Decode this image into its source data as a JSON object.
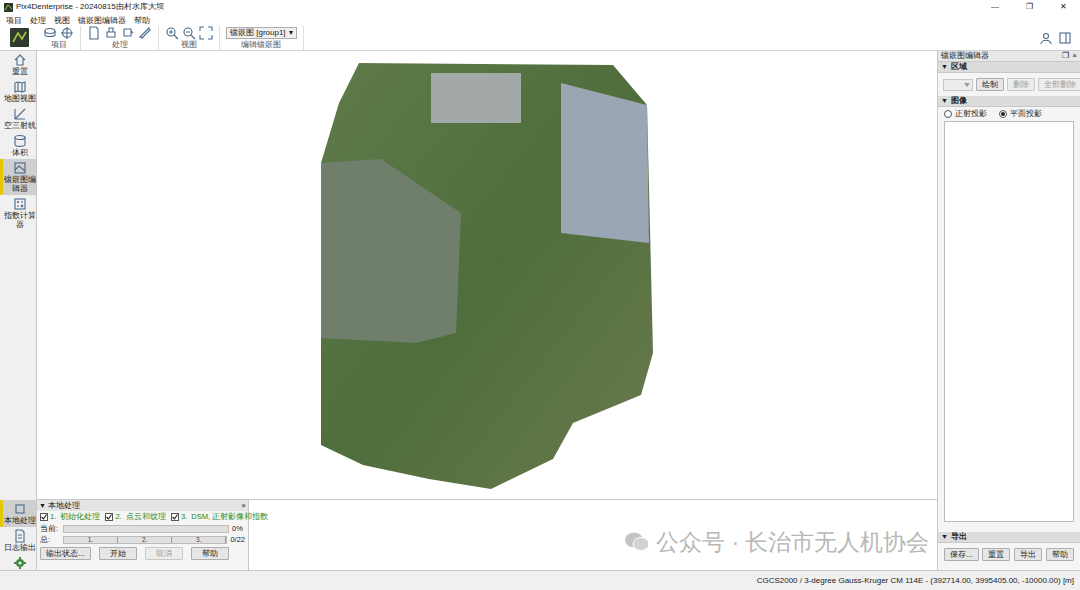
{
  "window": {
    "title": "Pix4Denterprise - 20240815由村水库大坝",
    "controls": [
      "—",
      "❐",
      "✕"
    ]
  },
  "menu": [
    "项目",
    "处理",
    "视图",
    "镶嵌图编辑器",
    "帮助"
  ],
  "toolbar": {
    "groups": [
      "项目",
      "处理",
      "视图",
      "编辑镶嵌图"
    ],
    "view_select": "镶嵌图 [group1]",
    "select_arrow": "▾"
  },
  "sidebar": {
    "items": [
      {
        "label": "重置",
        "selected": false
      },
      {
        "label": "地图视图",
        "selected": false
      },
      {
        "label": "空三射线",
        "selected": false
      },
      {
        "label": "体积",
        "selected": false
      },
      {
        "label": "镶嵌图编辑器",
        "selected": true
      },
      {
        "label": "指数计算器",
        "selected": false
      }
    ],
    "bottom_items": [
      {
        "label": "本地处理",
        "selected": true
      },
      {
        "label": "日志输出",
        "selected": false
      },
      {
        "label": "处理选项",
        "selected": false
      }
    ]
  },
  "right_panel": {
    "title": "镶嵌图编辑器",
    "controls": [
      "❐",
      "×"
    ],
    "region": {
      "arrow": "▼",
      "header": "区域",
      "buttons": [
        {
          "label": "绘制",
          "disabled": false
        },
        {
          "label": "删除",
          "disabled": true
        },
        {
          "label": "全部删除",
          "disabled": true
        }
      ]
    },
    "image": {
      "arrow": "▼",
      "header": "图像",
      "options": [
        {
          "label": "正射投影",
          "selected": false
        },
        {
          "label": "平面投影",
          "selected": true
        }
      ]
    },
    "export": {
      "arrow": "▼",
      "header": "导出",
      "buttons": [
        {
          "label": "保存...",
          "disabled": false
        },
        {
          "label": "重置",
          "disabled": false
        },
        {
          "label": "导出",
          "disabled": false
        },
        {
          "label": "帮助",
          "disabled": false
        }
      ]
    }
  },
  "processing": {
    "arrow": "▼",
    "title": "本地处理",
    "close": "×",
    "steps": [
      {
        "label": "1.  初始化处理",
        "checked": true
      },
      {
        "label": "2.  点云和纹理",
        "checked": true
      },
      {
        "label": "3.  DSM, 正射影像和指数",
        "checked": true
      }
    ],
    "current": {
      "label": "当前:",
      "level": 0,
      "reading": "0%"
    },
    "total": {
      "label": "总:",
      "segments": [
        "1.",
        "2.",
        "3."
      ],
      "level": 0,
      "reading": "0/22"
    },
    "buttons": [
      {
        "label": "输出状态...",
        "disabled": false
      },
      {
        "label": "开始",
        "disabled": false
      },
      {
        "label": "取消",
        "disabled": true
      },
      {
        "label": "帮助",
        "disabled": false
      }
    ]
  },
  "status_bar": "CGCS2000 / 3-degree Gauss-Kruger CM 114E - (392714.00, 3995405.00, -10000.00) [m]",
  "watermark": "公众号 · 长治市无人机协会"
}
